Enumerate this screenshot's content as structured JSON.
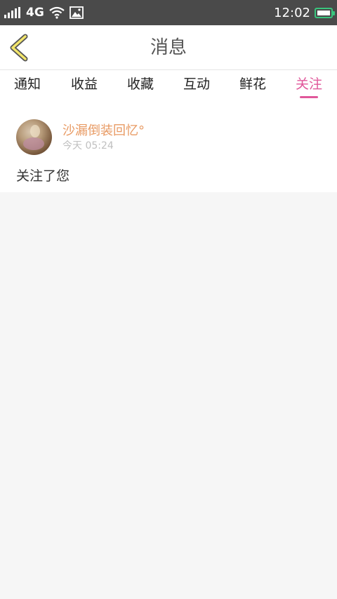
{
  "status_bar": {
    "network": "4G",
    "time": "12:02",
    "icons": [
      "signal-icon",
      "wifi-icon",
      "image-icon",
      "battery-icon"
    ]
  },
  "header": {
    "title": "消息",
    "back_icon": "chevron-left-icon"
  },
  "tabs": [
    {
      "label": "通知",
      "active": false
    },
    {
      "label": "收益",
      "active": false
    },
    {
      "label": "收藏",
      "active": false
    },
    {
      "label": "互动",
      "active": false
    },
    {
      "label": "鲜花",
      "active": false
    },
    {
      "label": "关注",
      "active": true
    }
  ],
  "messages": [
    {
      "sender": "沙漏倒装回忆°",
      "time": "今天 05:24",
      "text": "关注了您"
    }
  ],
  "colors": {
    "accent": "#e0579a",
    "sender_name": "#e89a63",
    "status_bar": "#4a4a4a",
    "battery": "#3ac47d",
    "back_arrow": "#f2e56b"
  }
}
